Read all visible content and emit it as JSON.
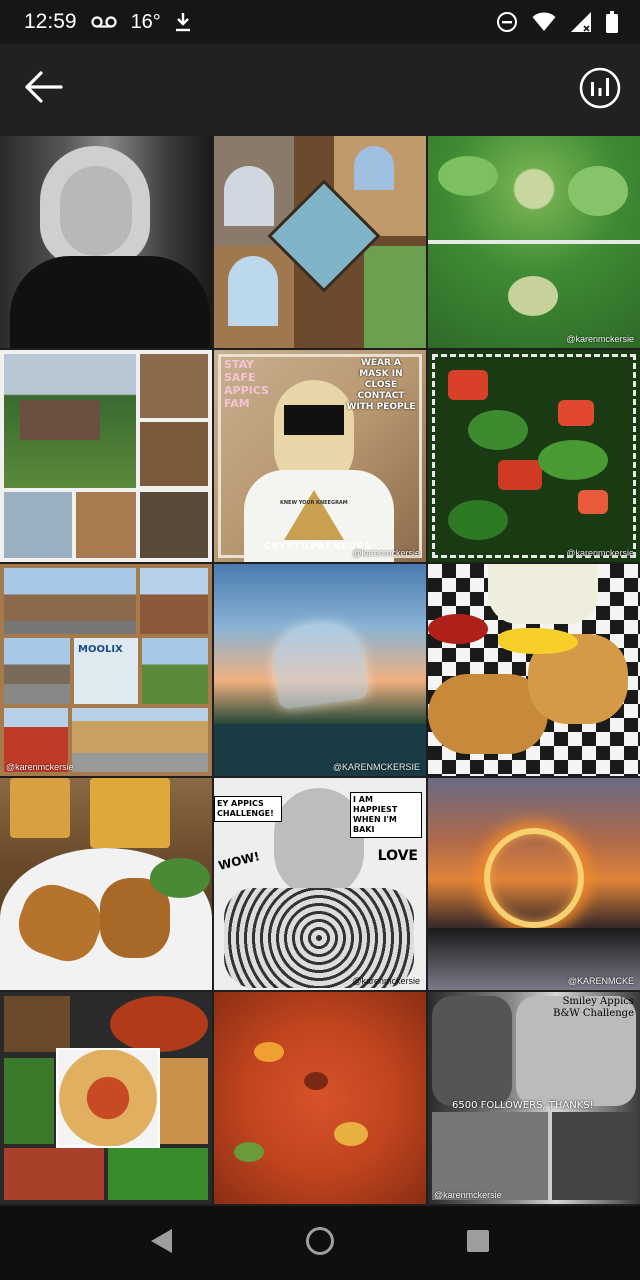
{
  "status_bar": {
    "time": "12:59",
    "temperature": "16°",
    "icons": [
      "voicemail-icon",
      "download-icon",
      "dnd-icon",
      "wifi-icon",
      "signal-icon",
      "battery-icon"
    ]
  },
  "app_bar": {
    "back_icon": "arrow-left-icon",
    "action_icon": "stats-icon"
  },
  "tiles": [
    {
      "name": "tile-portrait-bw"
    },
    {
      "name": "tile-cabin-interior-collage"
    },
    {
      "name": "tile-cauliflower-plants",
      "caption": "@karenmckersie"
    },
    {
      "name": "tile-cabin-exterior-collage"
    },
    {
      "name": "tile-stay-safe-mask",
      "left_text": "STAY SAFE APPICS FAM",
      "right_text": "WEAR A MASK IN CLOSE CONTACT WITH PEOPLE",
      "bottom_text": "CRYPTOPRENEURS",
      "shirt_text": "KNEW YOUR KNEEGRAM",
      "caption": "@karenmckersie"
    },
    {
      "name": "tile-salad",
      "caption": "@karenmckersie"
    },
    {
      "name": "tile-town-collage",
      "sign_text": "MOOLIX",
      "caption": "@karenmckersie"
    },
    {
      "name": "tile-glass-heart",
      "caption": "@KARENMCKERSIE"
    },
    {
      "name": "tile-fish-and-chips"
    },
    {
      "name": "tile-fish-and-beer"
    },
    {
      "name": "tile-comic-challenge",
      "bubble_left": "EY APPICS CHALLENGE!",
      "bubble_right": "I AM HAPPIEST WHEN I'M BAKI",
      "wow": "WOW!",
      "love": "LOVE",
      "caption": "@karenmckersie"
    },
    {
      "name": "tile-fire-ring-sunset",
      "caption": "@KARENMCKE"
    },
    {
      "name": "tile-spaghetti-collage"
    },
    {
      "name": "tile-chili-stew"
    },
    {
      "name": "tile-bw-challenge",
      "title": "Smiley Appics B&W Challenge",
      "followers": "6500 FOLLOWERS, THANKS!",
      "caption": "@karenmckersie"
    }
  ],
  "nav_bar": {
    "icons": [
      "nav-back-icon",
      "nav-home-icon",
      "nav-recents-icon"
    ]
  },
  "colors": {
    "status_bg": "#161616",
    "appbar_bg": "#212121",
    "grid_bg": "#1f1f1f",
    "nav_bg": "#0f0f0f"
  }
}
